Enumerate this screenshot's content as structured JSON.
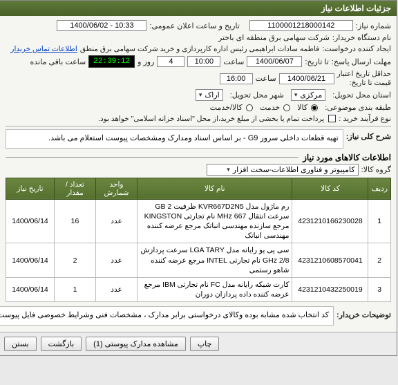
{
  "window": {
    "title": "جزئیات اطلاعات نیاز"
  },
  "header": {
    "need_no_label": "شماره نیاز:",
    "need_no": "1100001218000142",
    "announce_label": "تاریخ و ساعت اعلان عمومی:",
    "announce_val": "1400/06/02 - 10:33",
    "buyer_org_label": "نام دستگاه خریدار:",
    "buyer_org": "شرکت سهامی برق منطقه ای باختر",
    "creator_label": "ایجاد کننده درخواست:",
    "creator": "فاطمه سادات ابراهیمی رئیس اداره کارپردازی و خرید شرکت سهامی برق منطق",
    "contact_link": "اطلاعات تماس خریدار",
    "deadline_label": "مهلت ارسال پاسخ:",
    "deadline_until": "تا تاریخ:",
    "deadline_date": "1400/06/07",
    "time_word": "ساعت",
    "deadline_time": "10:00",
    "days_count": "4",
    "days_text": "روز و",
    "countdown": "22:39:12",
    "remain_text": "ساعت باقی مانده",
    "valid_until_label": "حداقل تاریخ اعتبار",
    "price_until_label": "قیمت تا تاریخ:",
    "valid_date": "1400/06/21",
    "valid_time": "16:00",
    "province_label": "استان محل تحویل:",
    "province": "مرکزی",
    "city_label": "شهر محل تحویل:",
    "city": "اراک",
    "class_label": "طبقه بندی موضوعی:",
    "class_goods": "کالا",
    "class_service": "خدمت",
    "class_both": "کالا/خدمت",
    "proc_label": "نوع فرآیند خرید :",
    "proc_text": "پرداخت تمام یا بخشی از مبلغ خرید،از محل \"اسناد خزانه اسلامی\" خواهد بود.",
    "desc_label": "شرح کلی نیاز:",
    "desc_text": "تهیه قطعات داخلی سرور G9 - بر اساس اسناد ومدارک ومشخصات پیوست استعلام می باشد."
  },
  "goods": {
    "section_title": "اطلاعات کالاهای مورد نیاز",
    "group_label": "گروه کالا:",
    "group_value": "کامپیوتر و فناوری اطلاعات-سخت افزار",
    "headers": {
      "row": "ردیف",
      "code": "کد کالا",
      "name": "نام کالا",
      "unit": "واحد شمارش",
      "qty": "تعداد / مقدار",
      "date": "تاریخ نیاز"
    },
    "rows": [
      {
        "row": "1",
        "code": "4231210166230028",
        "name": "رم ماژول مدل KVR667D2N5 ظرفیت GB 2 سرعت انتقال 667 MHz نام تجارتی KINGSTON مرجع سازنده مهندسی انباتک مرجع عرضه کننده مهندسی انباتک",
        "unit": "عدد",
        "qty": "16",
        "date": "1400/06/14"
      },
      {
        "row": "2",
        "code": "4231210608570041",
        "name": "سی پی یو رایانه مدل LGA TARY سرعت پردازش GHz 2/8 نام تجارتی INTEL مرجع عرضه کننده شاهو رستمی",
        "unit": "عدد",
        "qty": "2",
        "date": "1400/06/14"
      },
      {
        "row": "3",
        "code": "4231210432250019",
        "name": "کارت شبکه رایانه مدل FC نام تجارتی IBM مرجع عرضه کننده داده پردازان دوران",
        "unit": "عدد",
        "qty": "1",
        "date": "1400/06/14"
      }
    ]
  },
  "buyer_notes": {
    "label": "توضیحات خریدار:",
    "text": "کد انتخاب شده مشابه بوده وکالای درخواستی برابر مدارک ، مشخصات فنی وشرایط خصوصی فایل پیوست میباشد که میبایست فرم استعلام بهاء فایل مذکور توسط پیشنهاد دهنده تکمیل ، قیمت درج و تعهدنامه استعلام والزامات  مندرج درآن مهر وامضاء ودر سامانه بارگذاری شود."
  },
  "footer": {
    "close": "بستن",
    "back": "بازگشت",
    "attach": "مشاهده مدارک پیوستی (1)",
    "print": "چاپ"
  }
}
